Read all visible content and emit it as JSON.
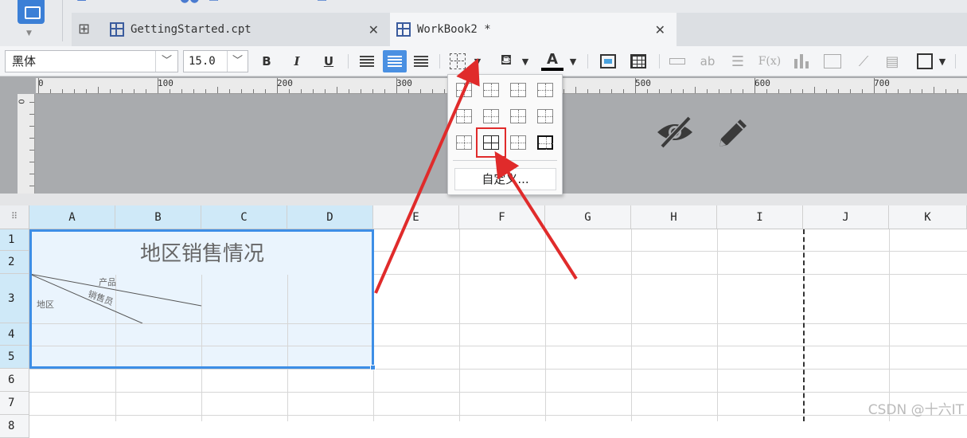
{
  "tabs": [
    {
      "label": "GettingStarted.cpt",
      "active": false
    },
    {
      "label": "WorkBook2 *",
      "active": true
    }
  ],
  "toolbar": {
    "font_family": "黑体",
    "font_size": "15.0",
    "bold": "B",
    "italic": "I",
    "underline": "U",
    "text_color_label": "A",
    "ab_label": "ab",
    "formula_label": "F(x)"
  },
  "border_popup": {
    "custom_label": "自定义..."
  },
  "ruler": {
    "labels": [
      "0",
      "100",
      "200",
      "300",
      "400",
      "500",
      "600",
      "700"
    ]
  },
  "sheet": {
    "columns": [
      "A",
      "B",
      "C",
      "D",
      "E",
      "F",
      "G",
      "H",
      "I",
      "J",
      "K"
    ],
    "rows": [
      "1",
      "2",
      "3",
      "4",
      "5",
      "6",
      "7",
      "8"
    ],
    "title": "地区销售情况",
    "diagonal_header": {
      "product": "产品",
      "salesperson": "销售员",
      "region": "地区"
    }
  },
  "watermark": "CSDN @十六IT",
  "colors": {
    "accent": "#3d8ee6",
    "selection_fill": "#eaf4fd",
    "annotation_red": "#e02b2b"
  }
}
